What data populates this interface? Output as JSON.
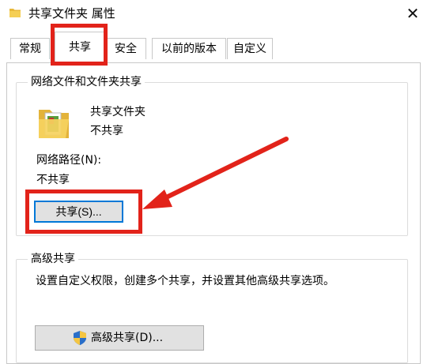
{
  "window": {
    "title": "共享文件夹 属性",
    "close_glyph": "✕"
  },
  "tabs": [
    {
      "label": "常规"
    },
    {
      "label": "共享",
      "active": true
    },
    {
      "label": "安全"
    },
    {
      "label": "以前的版本"
    },
    {
      "label": "自定义"
    }
  ],
  "network_sharing": {
    "group_title": "网络文件和文件夹共享",
    "folder_name": "共享文件夹",
    "folder_status": "不共享",
    "path_label": "网络路径(N):",
    "path_value": "不共享",
    "share_button": "共享(S)..."
  },
  "advanced_sharing": {
    "group_title": "高级共享",
    "description": "设置自定义权限，创建多个共享，并设置其他高级共享选项。",
    "button": "高级共享(D)...",
    "button_icon": "uac-shield-icon"
  },
  "annotations": {
    "highlight_color": "#e2231a"
  }
}
